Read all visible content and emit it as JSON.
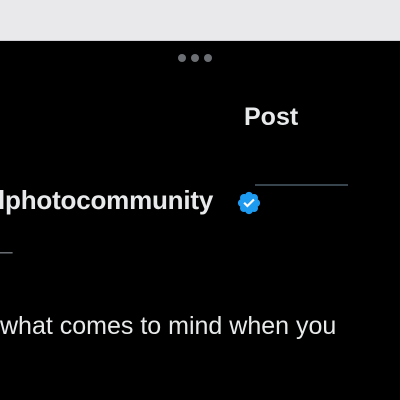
{
  "browser": {
    "menu_icon": "more-horizontal-icon"
  },
  "header": {
    "title": "Post"
  },
  "author": {
    "display_name": "lphotocommunity",
    "verified_icon": "verified-badge-icon",
    "verified_color": "#1d9bf0",
    "handle_fragment": "t_"
  },
  "post": {
    "text": "what comes to mind when you"
  }
}
